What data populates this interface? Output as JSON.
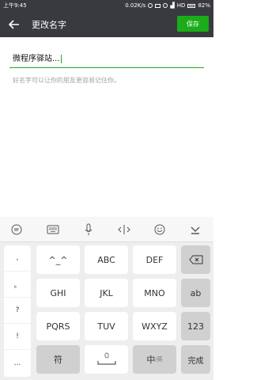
{
  "status": {
    "time": "上午9:45",
    "speed": "0.02K/s",
    "network": "HD",
    "battery": "82%"
  },
  "nav": {
    "title": "更改名字",
    "save_label": "保存"
  },
  "form": {
    "name_value": "微程序驿站...",
    "hint": "好名字可以让你的朋友更容易记住你。"
  },
  "keyboard": {
    "symbols": [
      ",",
      "。",
      "?",
      "!",
      "..."
    ],
    "row1": [
      "^_^",
      "ABC",
      "DEF"
    ],
    "row2": [
      "GHI",
      "JKL",
      "MNO"
    ],
    "row3": [
      "PQRS",
      "TUV",
      "WXYZ"
    ],
    "ab_label": "ab",
    "num_label": "123",
    "symbol_label": "符",
    "lang_label": "中",
    "lang_sub": "/英",
    "done_label": "完成"
  }
}
